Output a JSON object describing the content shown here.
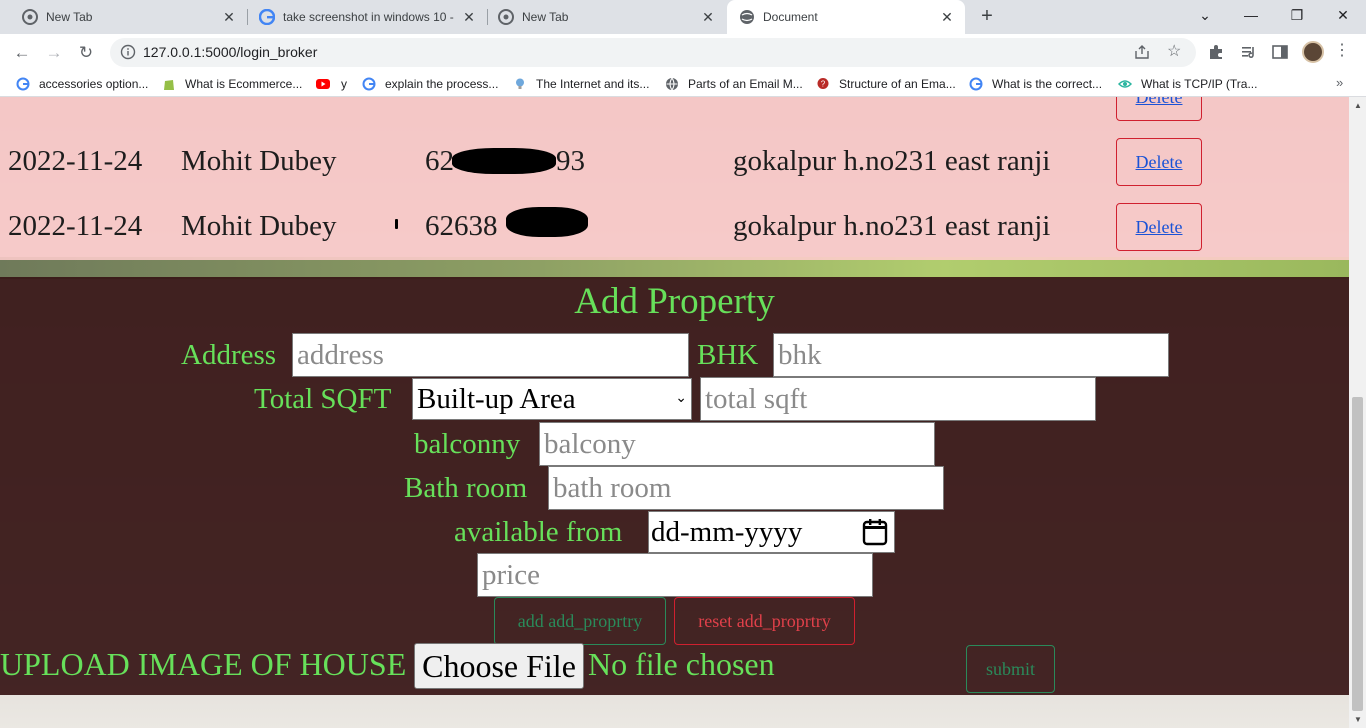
{
  "browser": {
    "tabs": [
      {
        "title": "New Tab",
        "active": false
      },
      {
        "title": "take screenshot in windows 10 -",
        "active": false
      },
      {
        "title": "New Tab",
        "active": false
      },
      {
        "title": "Document",
        "active": true
      }
    ],
    "new_tab": "+",
    "window_controls": {
      "dropdown": "⌄",
      "minimize": "—",
      "restore": "❐",
      "close": "✕"
    },
    "url": "127.0.0.1:5000/login_broker",
    "bookmarks": [
      {
        "label": "accessories option...",
        "icon": "google-icon"
      },
      {
        "label": "What is Ecommerce...",
        "icon": "shopify-icon"
      },
      {
        "label": "y",
        "icon": "youtube-icon"
      },
      {
        "label": "explain the process...",
        "icon": "google-icon"
      },
      {
        "label": "The Internet and its...",
        "icon": "bulb-icon"
      },
      {
        "label": "Parts of an Email M...",
        "icon": "globe-icon"
      },
      {
        "label": "Structure of an Ema...",
        "icon": "quora-icon"
      },
      {
        "label": "What is the correct...",
        "icon": "google-icon"
      },
      {
        "label": "What is TCP/IP (Tra...",
        "icon": "eye-icon"
      }
    ],
    "bookmarks_more": "»"
  },
  "table": {
    "rows": [
      {
        "date": "2022-11-24",
        "name": "Mohit Dubey",
        "phone_prefix": "62",
        "phone_suffix": "93",
        "address": "gokalpur h.no231 east ranji",
        "action": "Delete"
      },
      {
        "date": "2022-11-24",
        "name": "Mohit Dubey",
        "phone_prefix": "62638",
        "phone_suffix": "",
        "address": "gokalpur h.no231 east ranji",
        "action": "Delete"
      }
    ],
    "partial_row": {
      "action": "Delete"
    }
  },
  "form": {
    "title": "Add Property",
    "address_label": "Address",
    "address_placeholder": "address",
    "bhk_label": "BHK",
    "bhk_placeholder": "bhk",
    "sqft_label": "Total SQFT",
    "sqft_select_value": "Built-up Area",
    "sqft_placeholder": "total sqft",
    "balcony_label": "balconny",
    "balcony_placeholder": "balcony",
    "bath_label": "Bath room",
    "bath_placeholder": "bath room",
    "available_label": "available from",
    "date_value": "dd-mm-yyyy",
    "price_placeholder": "price",
    "add_button": "add add_proprtry",
    "reset_button": "reset add_proprtry",
    "upload_label": "UPLOAD IMAGE OF HOUSE",
    "choose_file": "Choose File",
    "no_file": "No file chosen",
    "submit": "submit"
  },
  "colors": {
    "form_text": "#67e05a",
    "panel_bg": "#371616",
    "row_bg": "#ffcdcd",
    "delete_border": "#d0202f",
    "link": "#1a52d6"
  }
}
